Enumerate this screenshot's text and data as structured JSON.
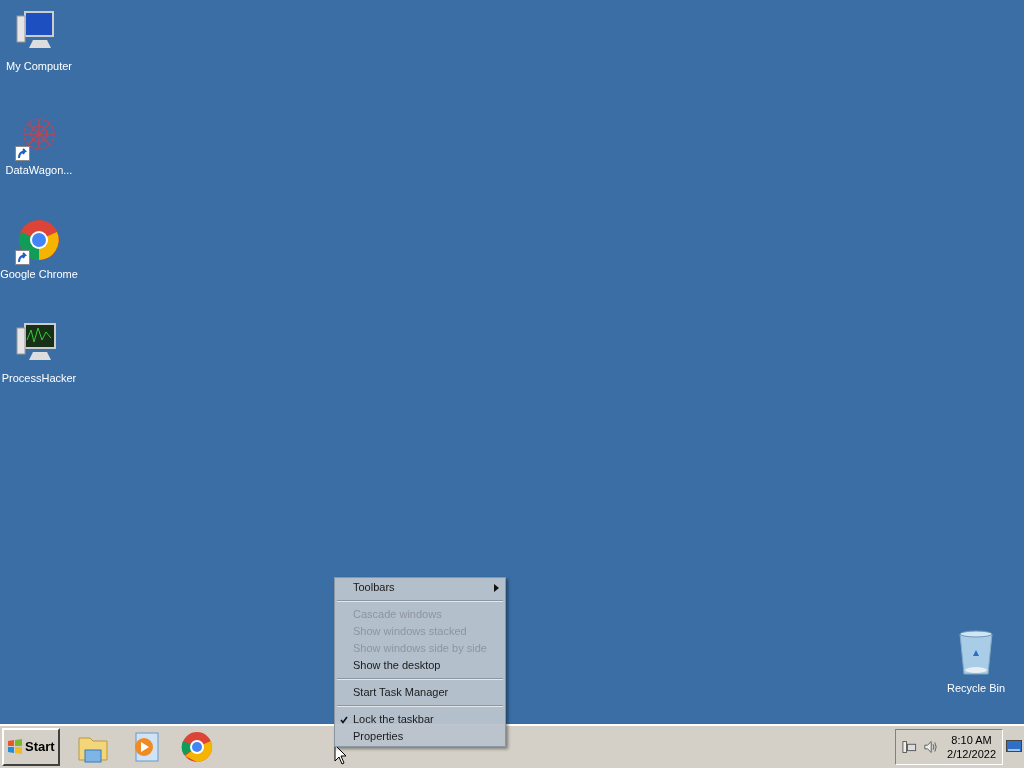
{
  "desktop_icons": [
    {
      "kind": "computer",
      "label": "My Computer",
      "shortcut": false
    },
    {
      "kind": "molecule",
      "label": "DataWagon...",
      "shortcut": true
    },
    {
      "kind": "chrome",
      "label": "Google Chrome",
      "shortcut": true
    },
    {
      "kind": "monitor",
      "label": "ProcessHacker",
      "shortcut": false
    }
  ],
  "recycle_bin": {
    "label": "Recycle Bin"
  },
  "context_menu": [
    {
      "kind": "item",
      "label": "Toolbars",
      "disabled": false,
      "checked": false,
      "submenu": true
    },
    {
      "kind": "separator"
    },
    {
      "kind": "item",
      "label": "Cascade windows",
      "disabled": true,
      "checked": false,
      "submenu": false
    },
    {
      "kind": "item",
      "label": "Show windows stacked",
      "disabled": true,
      "checked": false,
      "submenu": false
    },
    {
      "kind": "item",
      "label": "Show windows side by side",
      "disabled": true,
      "checked": false,
      "submenu": false
    },
    {
      "kind": "item",
      "label": "Show the desktop",
      "disabled": false,
      "checked": false,
      "submenu": false
    },
    {
      "kind": "separator"
    },
    {
      "kind": "item",
      "label": "Start Task Manager",
      "disabled": false,
      "checked": false,
      "submenu": false
    },
    {
      "kind": "separator"
    },
    {
      "kind": "item",
      "label": "Lock the taskbar",
      "disabled": false,
      "checked": true,
      "submenu": false
    },
    {
      "kind": "item",
      "label": "Properties",
      "disabled": false,
      "checked": false,
      "submenu": false
    }
  ],
  "taskbar": {
    "start_label": "Start",
    "pinned": [
      {
        "kind": "explorer"
      },
      {
        "kind": "media"
      },
      {
        "kind": "chrome"
      }
    ],
    "clock": {
      "time": "8:10 AM",
      "date": "2/12/2022"
    }
  }
}
